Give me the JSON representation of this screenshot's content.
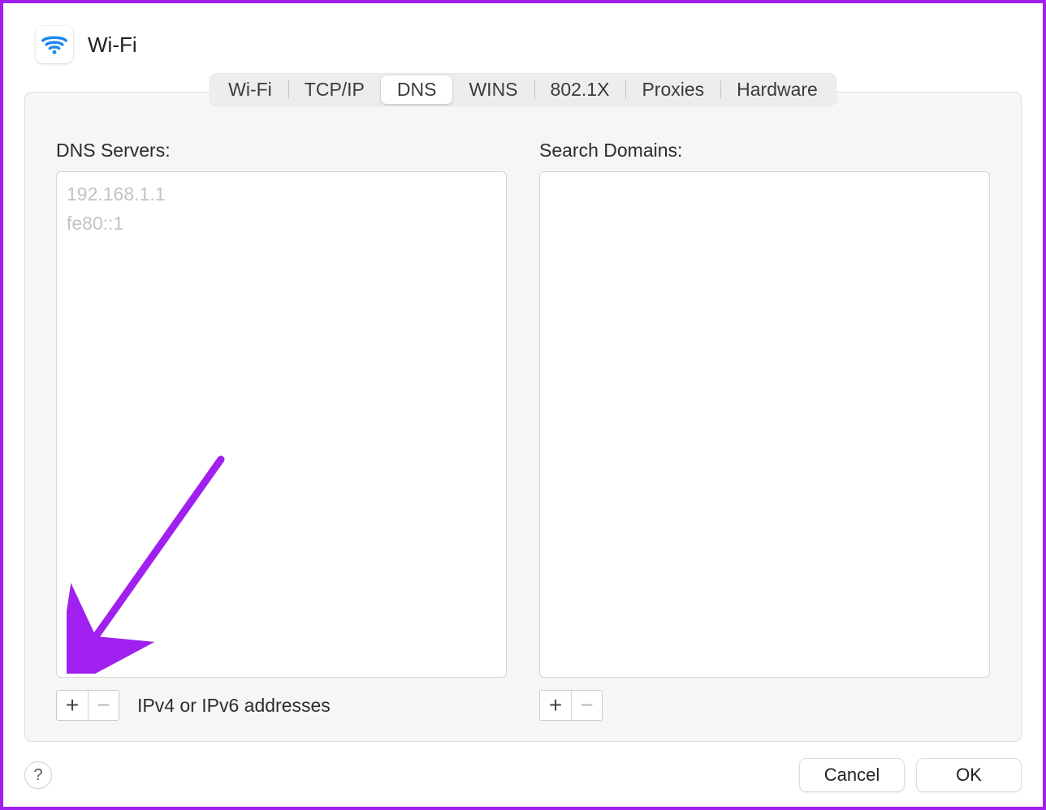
{
  "header": {
    "title": "Wi-Fi"
  },
  "tabs": {
    "wifi": "Wi-Fi",
    "tcpip": "TCP/IP",
    "dns": "DNS",
    "wins": "WINS",
    "dot1x": "802.1X",
    "proxies": "Proxies",
    "hardware": "Hardware"
  },
  "dns": {
    "servers_label": "DNS Servers:",
    "servers": [
      "192.168.1.1",
      "fe80::1"
    ],
    "hint": "IPv4 or IPv6 addresses",
    "domains_label": "Search Domains:"
  },
  "buttons": {
    "plus": "+",
    "minus": "−",
    "help": "?",
    "cancel": "Cancel",
    "ok": "OK"
  }
}
